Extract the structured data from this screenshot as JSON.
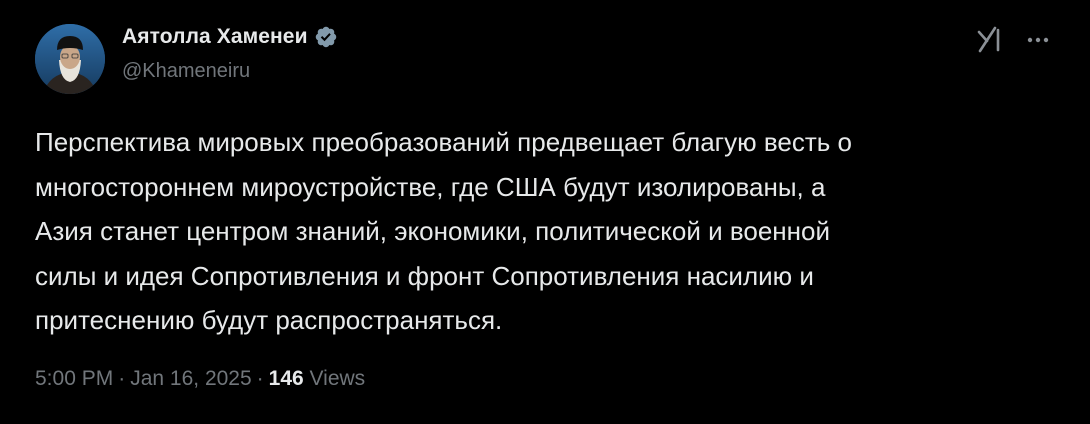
{
  "author": {
    "display_name": "Аятолла Хаменеи",
    "handle": "@Khameneiru",
    "verified": true,
    "avatar_icon": "portrait-avatar"
  },
  "actions": {
    "grok_icon": "grok-icon",
    "more_icon": "more-icon"
  },
  "tweet": {
    "text": "Перспектива мировых преобразований предвещает благую весть о\nмногостороннем мироустройстве, где США будут изолированы, а\nАзия станет центром знаний, экономики, политической и военной\nсилы и идея Сопротивления и фронт Сопротивления насилию и\nпритеснению будут распространяться."
  },
  "meta": {
    "time": "5:00 PM",
    "separator": "·",
    "date": "Jan 16, 2025",
    "views_count": "146",
    "views_label": "Views"
  },
  "colors": {
    "background": "#000000",
    "primary_text": "#e7e9ea",
    "secondary_text": "#71767b",
    "verified_badge": "#829aab"
  }
}
